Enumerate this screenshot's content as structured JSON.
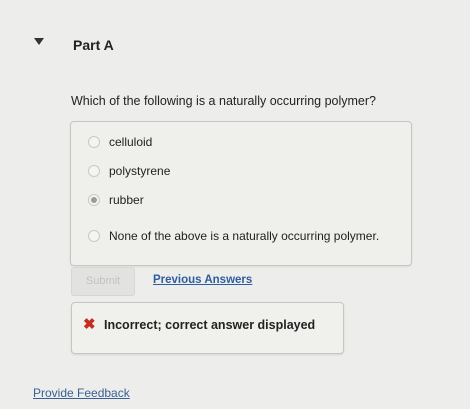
{
  "part": {
    "title": "Part A"
  },
  "question": {
    "text": "Which of the following is a naturally occurring polymer?"
  },
  "options": [
    {
      "label": "celluloid",
      "selected": false
    },
    {
      "label": "polystyrene",
      "selected": false
    },
    {
      "label": "rubber",
      "selected": true
    },
    {
      "label": "None of the above is a naturally occurring polymer.",
      "selected": false
    }
  ],
  "actions": {
    "submit_label": "Submit",
    "previous_answers_label": "Previous Answers"
  },
  "feedback": {
    "icon": "x-icon",
    "mark": "✖",
    "text": "Incorrect; correct answer displayed",
    "color": "#c62d1f"
  },
  "footer": {
    "provide_feedback_label": "Provide Feedback"
  }
}
